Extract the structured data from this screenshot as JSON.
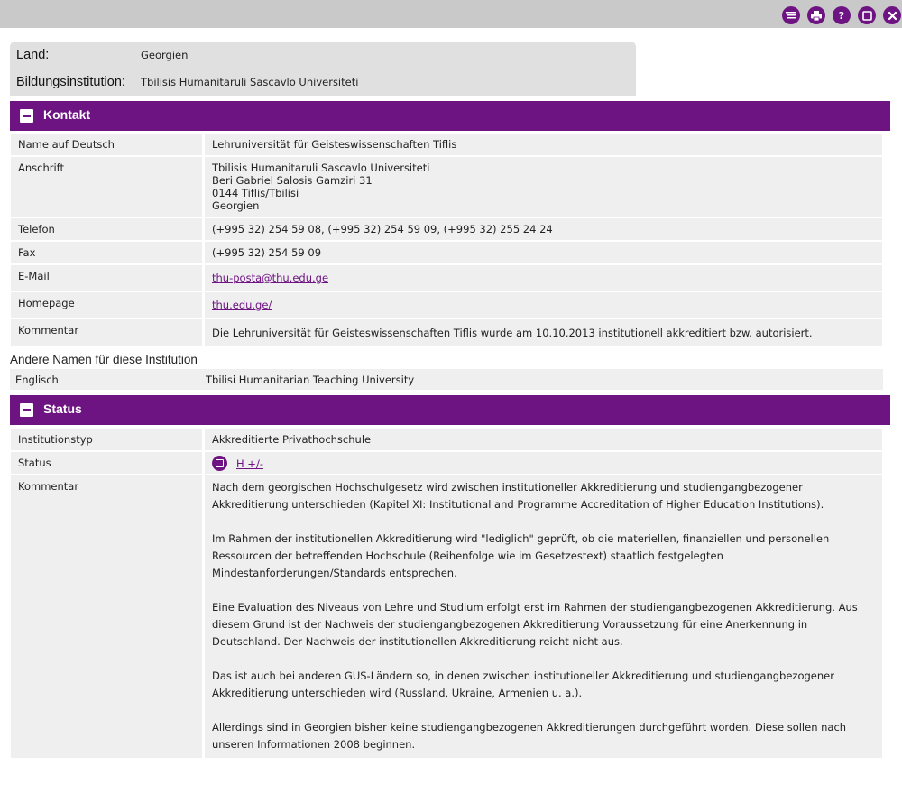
{
  "toolbar": {
    "icons": [
      "list-icon",
      "print-icon",
      "help-icon",
      "window-icon",
      "close-icon"
    ],
    "help_glyph": "?",
    "accent": "#6e1482"
  },
  "summary": {
    "country_label": "Land:",
    "country_value": "Georgien",
    "institution_label": "Bildungsinstitution:",
    "institution_value": "Tbilisis Humanitaruli Sascavlo Universiteti"
  },
  "contact": {
    "title": "Kontakt",
    "rows": [
      {
        "label": "Name auf Deutsch",
        "value": "Lehruniversität für Geisteswissenschaften Tiflis"
      },
      {
        "label": "Anschrift",
        "lines": [
          "Tbilisis Humanitaruli Sascavlo Universiteti",
          "Beri Gabriel Salosis Gamziri 31",
          "0144 Tiflis/Tbilisi",
          "Georgien"
        ]
      },
      {
        "label": "Telefon",
        "value": "(+995 32) 254 59 08, (+995 32) 254 59 09, (+995 32) 255 24 24"
      },
      {
        "label": "Fax",
        "value": "(+995 32) 254 59 09"
      },
      {
        "label": "E-Mail",
        "value": "thu-posta@thu.edu.ge"
      },
      {
        "label": "Homepage",
        "value": "thu.edu.ge/"
      },
      {
        "label": "Kommentar",
        "value": "Die Lehruniversität für Geisteswissenschaften Tiflis wurde am 10.10.2013 institutionell akkreditiert bzw. autorisiert."
      }
    ]
  },
  "other_names": {
    "title": "Andere Namen für diese Institution",
    "rows": [
      {
        "label": "Englisch",
        "value": "Tbilisi Humanitarian Teaching University"
      }
    ]
  },
  "status": {
    "title": "Status",
    "type_label": "Institutionstyp",
    "type_value": "Akkreditierte Privathochschule",
    "status_label": "Status",
    "status_link": "H +/-",
    "comment_label": "Kommentar",
    "paragraphs": [
      "Nach dem georgischen Hochschulgesetz wird zwischen institutioneller Akkreditierung und studiengangbezogener Akkreditierung unterschieden (Kapitel XI: Institutional and Programme Accreditation of Higher Education Institutions).",
      "Im Rahmen der institutionellen Akkreditierung wird \"lediglich\" geprüft, ob die materiellen, finanziellen und personellen Ressourcen der betreffenden Hochschule (Reihenfolge wie im Gesetzestext) staatlich festgelegten Mindestanforderungen/Standards entsprechen.",
      "Eine Evaluation des Niveaus von Lehre und Studium erfolgt erst im Rahmen der studiengangbezogenen Akkreditierung. Aus diesem Grund ist der Nachweis der studiengangbezogenen Akkreditierung Voraussetzung für eine Anerkennung in Deutschland. Der Nachweis der institutionellen Akkreditierung reicht nicht aus.",
      "Das ist auch bei anderen GUS-Ländern so, in denen zwischen institutioneller Akkreditierung und studiengangbezogener Akkreditierung unterschieden wird (Russland, Ukraine, Armenien u. a.).",
      "Allerdings sind in Georgien bisher keine studiengangbezogenen Akkreditierungen durchgeführt worden. Diese sollen nach unseren Informationen 2008 beginnen."
    ]
  }
}
